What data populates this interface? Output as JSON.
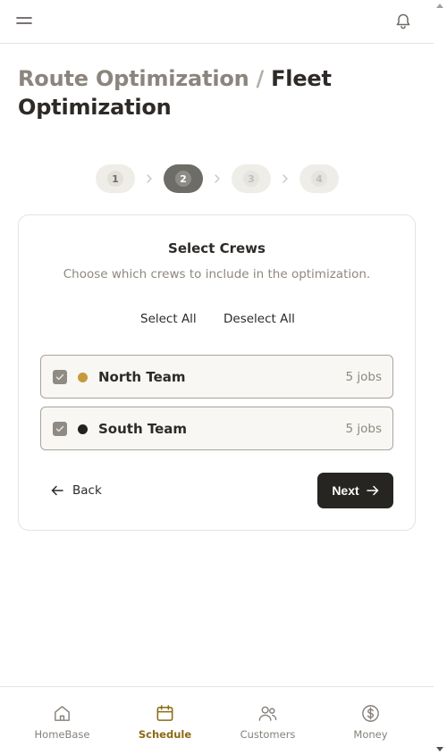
{
  "header": {
    "breadcrumb_parent": "Route Optimization",
    "breadcrumb_separator": "/",
    "breadcrumb_current": "Fleet Optimization",
    "menu_icon": "hamburger-menu-icon",
    "notification_icon": "bell-icon"
  },
  "stepper": {
    "steps": [
      {
        "label": "1",
        "state": "done"
      },
      {
        "label": "2",
        "state": "active"
      },
      {
        "label": "3",
        "state": "pending"
      },
      {
        "label": "4",
        "state": "pending"
      }
    ],
    "separator_icon": "chevron-right-icon"
  },
  "card": {
    "title": "Select Crews",
    "subtitle": "Choose which crews to include in the optimization.",
    "select_all_label": "Select All",
    "deselect_all_label": "Deselect All",
    "crews": [
      {
        "name": "North Team",
        "jobs": "5 jobs",
        "checked": true,
        "color": "#c49a3c"
      },
      {
        "name": "South Team",
        "jobs": "5 jobs",
        "checked": true,
        "color": "#24221f"
      }
    ],
    "back_label": "Back",
    "next_label": "Next"
  },
  "bottom_nav": {
    "items": [
      {
        "label": "HomeBase",
        "icon": "home-icon",
        "active": false
      },
      {
        "label": "Schedule",
        "icon": "calendar-icon",
        "active": true
      },
      {
        "label": "Customers",
        "icon": "users-icon",
        "active": false
      },
      {
        "label": "Money",
        "icon": "dollar-circle-icon",
        "active": false
      }
    ]
  },
  "colors": {
    "accent": "#8a6a14",
    "primary_button": "#272522",
    "muted_text": "#8e887f"
  }
}
